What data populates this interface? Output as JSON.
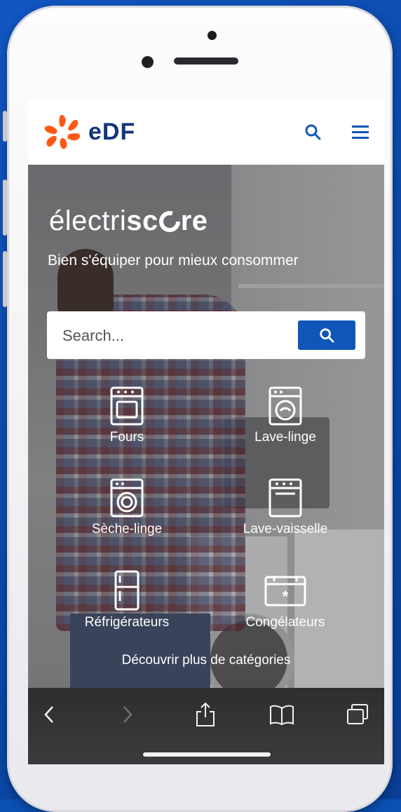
{
  "header": {
    "logo_text": "eDF",
    "search_icon": "search-icon",
    "menu_icon": "hamburger-menu-icon"
  },
  "hero": {
    "brand_light": "électri",
    "brand_bold": "sc",
    "brand_o": "O",
    "brand_end": "re",
    "tagline": "Bien s'équiper pour mieux consommer",
    "search_placeholder": "Search..."
  },
  "categories": [
    {
      "label": "Fours",
      "icon": "oven-icon"
    },
    {
      "label": "Lave-linge",
      "icon": "washing-machine-icon"
    },
    {
      "label": "Sèche-linge",
      "icon": "dryer-icon"
    },
    {
      "label": "Lave-vaisselle",
      "icon": "dishwasher-icon"
    },
    {
      "label": "Réfrigérateurs",
      "icon": "fridge-icon"
    },
    {
      "label": "Congélateurs",
      "icon": "freezer-icon"
    }
  ],
  "more_link": "Découvrir plus de catégories",
  "browser_toolbar": {
    "back": "back-chevron-icon",
    "forward": "forward-chevron-icon",
    "share": "share-icon",
    "bookmarks": "bookmarks-icon",
    "tabs": "tabs-icon"
  },
  "colors": {
    "edf_orange": "#fe5815",
    "edf_navy": "#10367a",
    "accent_blue": "#1056b8",
    "page_background": "#0b4fb0"
  }
}
